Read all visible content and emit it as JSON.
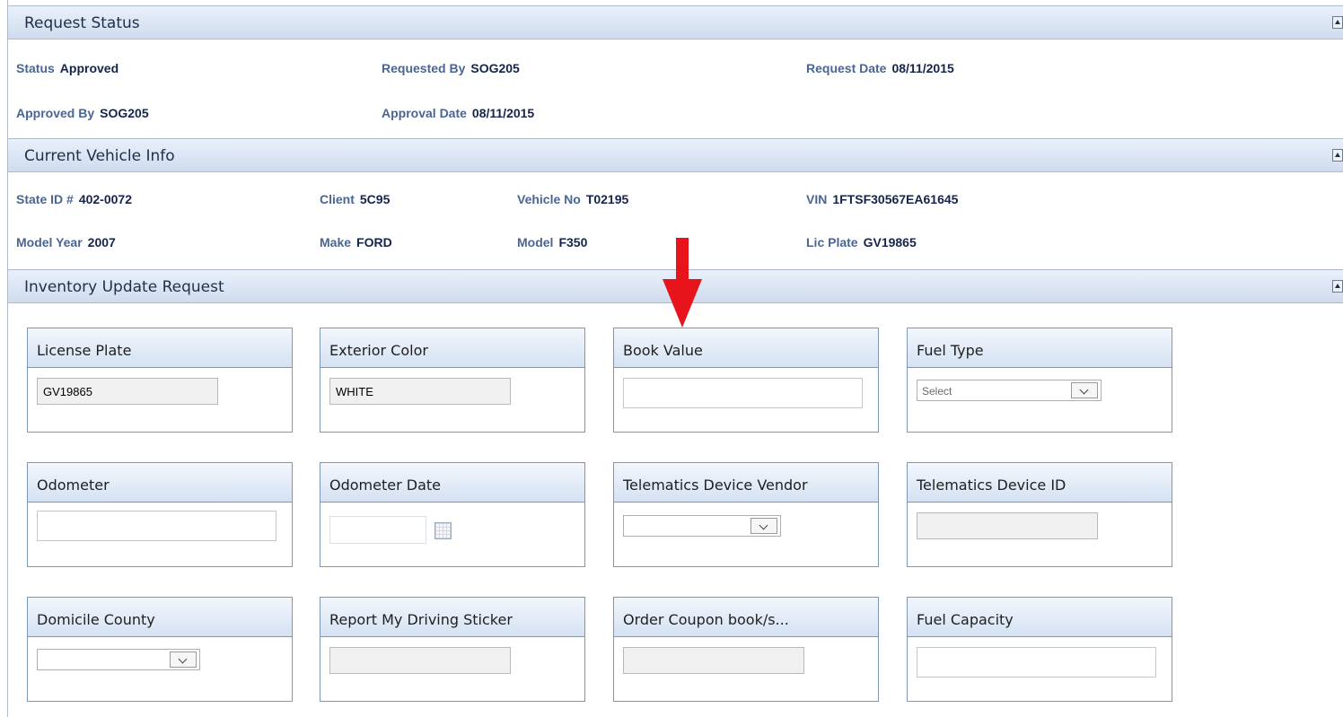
{
  "request_status": {
    "title": "Request Status",
    "status_label": "Status",
    "status_value": "Approved",
    "requested_by_label": "Requested By",
    "requested_by_value": "SOG205",
    "request_date_label": "Request Date",
    "request_date_value": "08/11/2015",
    "approved_by_label": "Approved By",
    "approved_by_value": "SOG205",
    "approval_date_label": "Approval Date",
    "approval_date_value": "08/11/2015"
  },
  "vehicle_info": {
    "title": "Current Vehicle Info",
    "state_id_label": "State ID #",
    "state_id_value": "402-0072",
    "client_label": "Client",
    "client_value": "5C95",
    "vehicle_no_label": "Vehicle No",
    "vehicle_no_value": "T02195",
    "vin_label": "VIN",
    "vin_value": "1FTSF30567EA61645",
    "model_year_label": "Model Year",
    "model_year_value": "2007",
    "make_label": "Make",
    "make_value": "FORD",
    "model_label": "Model",
    "model_value": "F350",
    "lic_plate_label": "Lic Plate",
    "lic_plate_value": "GV19865"
  },
  "inventory": {
    "title": "Inventory Update Request",
    "license_plate": {
      "label": "License Plate",
      "value": "GV19865"
    },
    "exterior_color": {
      "label": "Exterior Color",
      "value": "WHITE"
    },
    "book_value": {
      "label": "Book Value",
      "value": ""
    },
    "fuel_type": {
      "label": "Fuel Type",
      "value": "Select"
    },
    "odometer": {
      "label": "Odometer",
      "value": ""
    },
    "odometer_date": {
      "label": "Odometer Date",
      "value": ""
    },
    "telematics_vendor": {
      "label": "Telematics Device Vendor",
      "value": ""
    },
    "telematics_id": {
      "label": "Telematics Device ID",
      "value": ""
    },
    "domicile_county": {
      "label": "Domicile County",
      "value": ""
    },
    "driving_sticker": {
      "label": "Report My Driving Sticker",
      "value": ""
    },
    "coupon_book": {
      "label": "Order Coupon book/s...",
      "value": ""
    },
    "fuel_capacity": {
      "label": "Fuel Capacity",
      "value": ""
    }
  },
  "annotation": {
    "arrow_color": "#e8141b"
  }
}
